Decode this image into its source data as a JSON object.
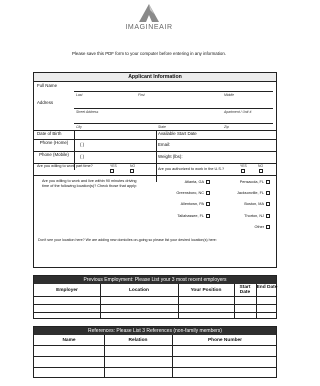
{
  "header": {
    "brand": "IMAGINEAIR",
    "notice": "Please save this PDF form to your computer before entering in any information."
  },
  "application": {
    "title": "Applicant Information",
    "full_name": "Full Name",
    "last": "Last",
    "first": "First",
    "middle": "Middle",
    "address": "Address",
    "street": "Street Address",
    "apartment": "Apartment / Unit #",
    "city": "City",
    "state": "State",
    "zip": "Zip",
    "dob": "Date of Birth",
    "start_date": "Available Start Date",
    "phone_home": "Phone (Home)",
    "phone_mobile": "Phone (Mobile)",
    "phone_placeholder": "(     )",
    "email": "Email:",
    "weight": "Weight (lbs):",
    "part_time": "Are you willing to work part time?",
    "authorized": "Are you authorized to work in the U.S.?",
    "yes": "YES",
    "no": "NO",
    "relocate": "Are you willing to work and live within 90 minutes driving time of the following location(s)? Check those that apply:",
    "locations_left": [
      "Atlanta, GA",
      "Greensboro, NC",
      "Allentown, PA",
      "Tallahassee, FL"
    ],
    "locations_right": [
      "Pensacola, FL",
      "Jacksonville, FL",
      "Boston, MA",
      "Thorton, NJ",
      "Other"
    ],
    "footer": "Don't see your location here? We are adding new domiciles on-going so please list your desired location(s) here:"
  },
  "employment": {
    "title": "Previous Employment: Please List your 3 most recent employers",
    "columns": [
      "Employer",
      "Location",
      "Your Position",
      "Start Date",
      "End Date"
    ]
  },
  "references": {
    "title": "References: Please List 3 References (non-family members)",
    "columns": [
      "Name",
      "Relation",
      "Phone Number"
    ]
  }
}
